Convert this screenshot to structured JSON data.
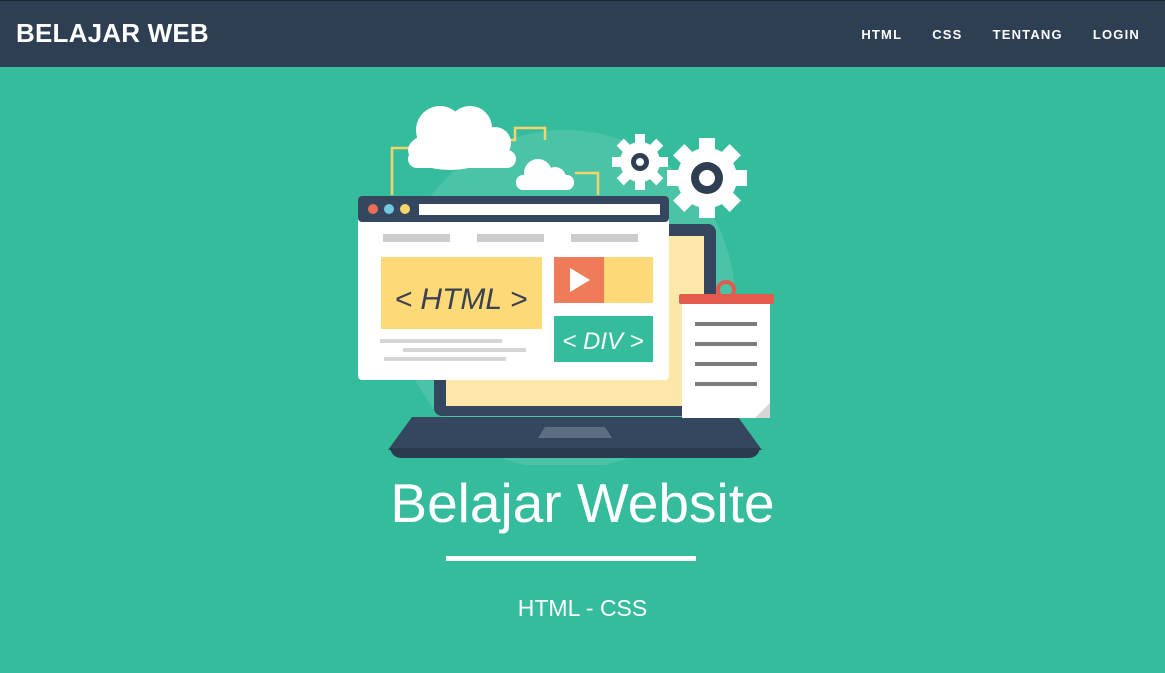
{
  "navbar": {
    "brand": "BELAJAR WEB",
    "links": [
      {
        "label": "HTML"
      },
      {
        "label": "CSS"
      },
      {
        "label": "TENTANG"
      },
      {
        "label": "LOGIN"
      }
    ]
  },
  "hero": {
    "title": "Belajar Website",
    "subtitle": "HTML - CSS",
    "illustration": {
      "html_tag": "< HTML >",
      "div_tag": "< DIV >",
      "icons": [
        "cloud-icon",
        "gear-icon",
        "laptop-icon",
        "browser-window-icon",
        "play-icon",
        "clipboard-icon"
      ]
    }
  },
  "colors": {
    "background": "#34bc9c",
    "navbar": "#2e3e53",
    "text": "#ffffff"
  }
}
